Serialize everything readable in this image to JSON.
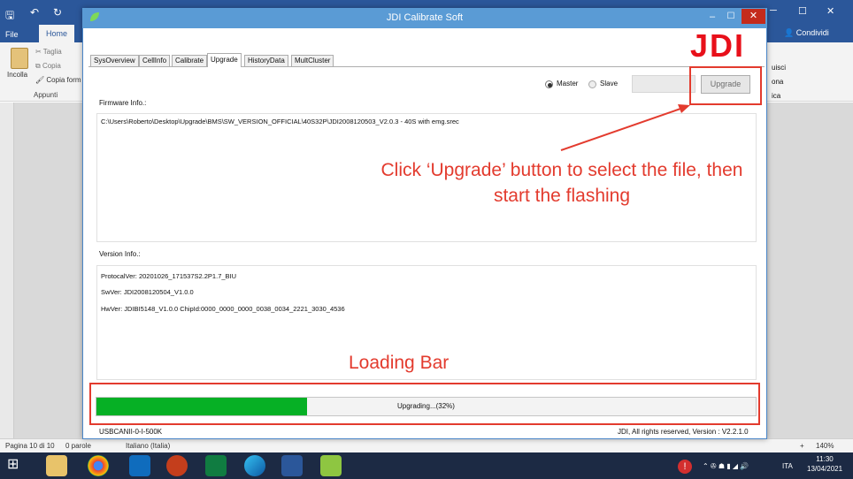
{
  "word": {
    "tabs": [
      "File",
      "Home"
    ],
    "condividi": "Condividi",
    "paste_label": "Incolla",
    "clipboard": {
      "cut": "Taglia",
      "copy": "Copia",
      "format_painter": "Copia form",
      "group": "Appunti"
    },
    "right_items": [
      "uisci",
      "ona",
      "ica"
    ],
    "status": {
      "page": "Pagina 10 di 10",
      "words": "0 parole",
      "language": "Italiano (Italia)",
      "zoom": "140%"
    }
  },
  "taskbar": {
    "language": "ITA",
    "time": "11:30",
    "date": "13/04/2021"
  },
  "window": {
    "title": "JDI Calibrate Soft",
    "logo": "JDI",
    "tabs": [
      "SysOverview",
      "CellInfo",
      "Calibrate",
      "Upgrade",
      "HistoryData",
      "MultCluster"
    ],
    "active_tab": "Upgrade",
    "radio": {
      "master": "Master",
      "slave": "Slave",
      "selected": "Master"
    },
    "upgrade_button": "Upgrade",
    "firmware_label": "Firmware Info.:",
    "firmware_path": "C:\\Users\\Roberto\\Desktop\\Upgrade\\BMS\\SW_VERSION_OFFICIAL\\40S32P\\JDI2008120503_V2.0.3 - 40S with emg.srec",
    "version_label": "Version Info.:",
    "protocol_ver": "ProtocalVer: 20201026_171537S2.2P1.7_BIU",
    "sw_ver": "SwVer: JDI2008120504_V1.0.0",
    "hw_ver": "HwVer: JDIBI5148_V1.0.0 ChipId:0000_0000_0000_0038_0034_2221_3030_4536",
    "progress": {
      "text": "Upgrading...(32%)",
      "fraction": 0.32
    },
    "status_left": "USBCANII-0-I-500K",
    "status_right": "JDI,  All rights reserved, Version : V2.2.1.0"
  },
  "annotations": {
    "instruction": "Click ‘Upgrade’ button to select the file, then start the flashing",
    "loading": "Loading Bar",
    "color": "#e33b2e"
  }
}
